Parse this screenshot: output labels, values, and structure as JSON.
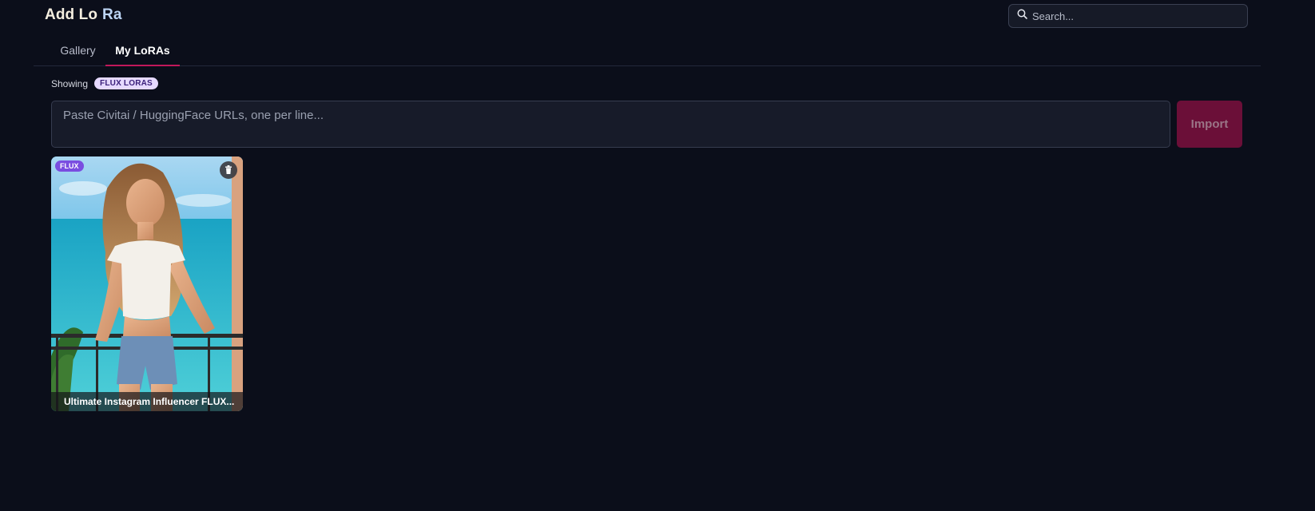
{
  "header": {
    "title_part1": "Add Lo",
    "title_part2": "Ra"
  },
  "search": {
    "placeholder": "Search...",
    "icon": "search-icon"
  },
  "tabs": [
    {
      "label": "Gallery",
      "active": false
    },
    {
      "label": "My LoRAs",
      "active": true
    }
  ],
  "filter": {
    "label": "Showing",
    "badge": "FLUX LORAS"
  },
  "import": {
    "placeholder": "Paste Civitai / HuggingFace URLs, one per line...",
    "button_label": "Import"
  },
  "loras": [
    {
      "badge": "FLUX",
      "title": "Ultimate Instagram Influencer FLUX...",
      "delete_icon": "trash-icon"
    }
  ],
  "colors": {
    "background": "#0b0e1a",
    "accent": "#c2185b",
    "import_button": "#6b0f38",
    "flux_badge": "#7a4de0"
  }
}
